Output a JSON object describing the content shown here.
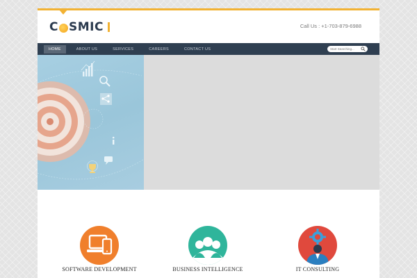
{
  "brand": {
    "name": "COSMIC",
    "accent": "#f2b233",
    "nav_bg": "#2f3f51"
  },
  "header": {
    "call_text": "Call Us : +1-703-879-6988"
  },
  "nav": {
    "items": [
      {
        "label": "HOME",
        "active": true
      },
      {
        "label": "ABOUT US",
        "active": false
      },
      {
        "label": "SERVICES",
        "active": false
      },
      {
        "label": "CAREERS",
        "active": false
      },
      {
        "label": "CONTACT US",
        "active": false
      }
    ]
  },
  "search": {
    "placeholder": "Start Searching..."
  },
  "services": [
    {
      "title": "SOFTWARE DEVELOPMENT",
      "icon": "devices-icon",
      "color": "#f07f2c"
    },
    {
      "title": "BUSINESS INTELLIGENCE",
      "icon": "team-icon",
      "color": "#2fb59b"
    },
    {
      "title": "IT CONSULTING",
      "icon": "consultant-icon",
      "color": "#e0493d"
    }
  ]
}
